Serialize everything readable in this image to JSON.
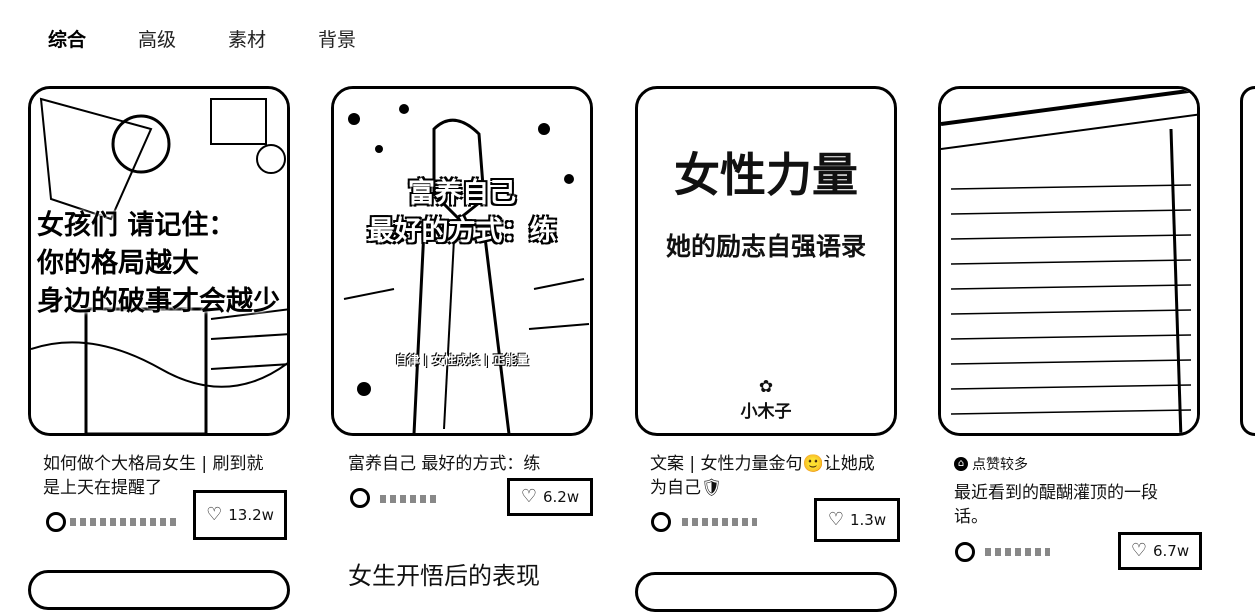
{
  "tabs": [
    "综合",
    "高级",
    "素材",
    "背景"
  ],
  "cards": [
    {
      "overlay_lines": [
        "女孩们 请记住：",
        "你的格局越大",
        "身边的破事才会越少"
      ],
      "caption": "如何做个大格局女生 | 刷到就是上天在提醒了",
      "likes": "13.2w"
    },
    {
      "overlay_lines": [
        "富养自己",
        "最好的方式：练"
      ],
      "overlay_small": "自律 | 女性成长 | 正能量",
      "caption": "富养自己 最好的方式：练",
      "likes": "6.2w"
    },
    {
      "big_title": "女性力量",
      "sub_title": "她的励志自强语录",
      "logo_text": "小木子",
      "caption": "文案 | 女性力量金句🙂让她成为自己🛡",
      "likes": "1.3w"
    },
    {
      "tag_icon": "home-icon",
      "tag_text": "点赞较多",
      "caption": "最近看到的醍醐灌顶的一段话。",
      "likes": "6.7w"
    }
  ],
  "bottom": {
    "text": "女生开悟后的表现"
  }
}
